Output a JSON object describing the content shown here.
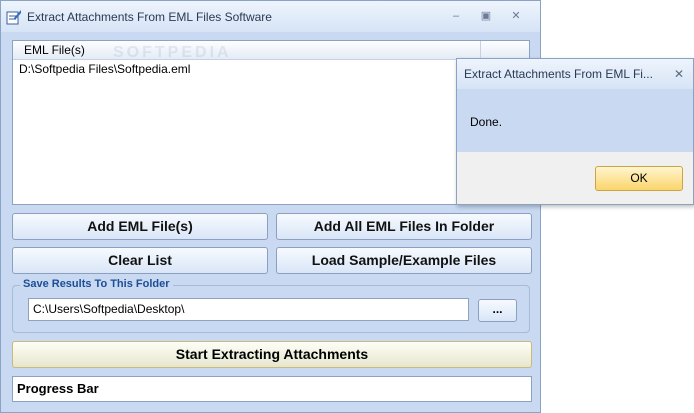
{
  "window": {
    "title": "Extract Attachments From EML Files Software",
    "minimize_glyph": "–",
    "maximize_glyph": "▣",
    "close_glyph": "✕"
  },
  "file_list": {
    "column_header": "EML File(s)",
    "watermark": "SOFTPEDIA",
    "rows": [
      "D:\\Softpedia Files\\Softpedia.eml"
    ]
  },
  "buttons": {
    "add_files": "Add EML File(s)",
    "add_folder": "Add All EML Files In Folder",
    "clear_list": "Clear List",
    "load_sample": "Load Sample/Example Files",
    "browse": "...",
    "start": "Start Extracting Attachments"
  },
  "save_group": {
    "label": "Save Results To This Folder",
    "folder_value": "C:\\Users\\Softpedia\\Desktop\\"
  },
  "progress": {
    "label": "Progress Bar"
  },
  "dialog": {
    "title": "Extract Attachments From EML Fi...",
    "message": "Done.",
    "ok_label": "OK",
    "close_glyph": "✕"
  },
  "colors": {
    "window_bg": "#c8d9f1",
    "start_button": "#e6e6cf",
    "ok_button": "#fbd56b"
  },
  "icons": [
    "app-icon",
    "minimize-icon",
    "maximize-icon",
    "close-icon",
    "dialog-close-icon"
  ]
}
